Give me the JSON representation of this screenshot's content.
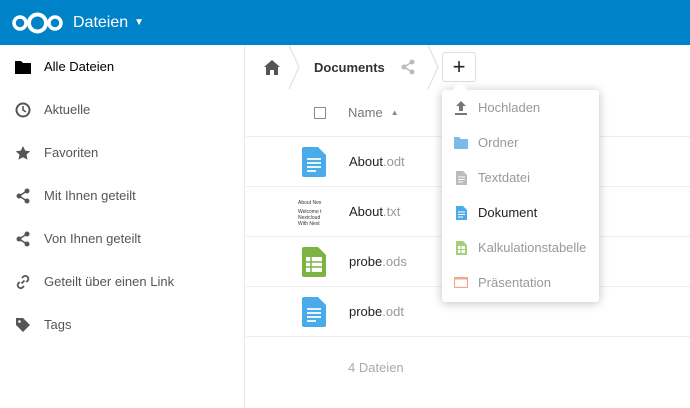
{
  "header": {
    "app_title": "Dateien",
    "brand_color": "#0082c9"
  },
  "sidebar": {
    "items": [
      {
        "label": "Alle Dateien",
        "icon": "folder-icon",
        "active": true
      },
      {
        "label": "Aktuelle",
        "icon": "clock-icon"
      },
      {
        "label": "Favoriten",
        "icon": "star-icon"
      },
      {
        "label": "Mit Ihnen geteilt",
        "icon": "share-icon"
      },
      {
        "label": "Von Ihnen geteilt",
        "icon": "share-icon"
      },
      {
        "label": "Geteilt über einen Link",
        "icon": "link-icon"
      },
      {
        "label": "Tags",
        "icon": "tag-icon"
      }
    ]
  },
  "breadcrumb": {
    "current": "Documents"
  },
  "file_list": {
    "column_name": "Name",
    "files": [
      {
        "base": "About",
        "ext": ".odt",
        "type": "document"
      },
      {
        "base": "About",
        "ext": ".txt",
        "type": "text",
        "thumb_lines": [
          "About Nex",
          "Welcome t",
          "Nextcloud",
          "With Next"
        ]
      },
      {
        "base": "probe",
        "ext": ".ods",
        "type": "spreadsheet"
      },
      {
        "base": "probe",
        "ext": ".odt",
        "type": "document"
      }
    ],
    "summary": "4 Dateien"
  },
  "new_menu": {
    "button_label": "+",
    "items": [
      {
        "label": "Hochladen",
        "icon": "upload-icon"
      },
      {
        "label": "Ordner",
        "icon": "folder-icon"
      },
      {
        "label": "Textdatei",
        "icon": "text-file-icon"
      },
      {
        "label": "Dokument",
        "icon": "document-icon",
        "hover": true
      },
      {
        "label": "Kalkulationstabelle",
        "icon": "spreadsheet-icon"
      },
      {
        "label": "Präsentation",
        "icon": "presentation-icon"
      }
    ]
  }
}
